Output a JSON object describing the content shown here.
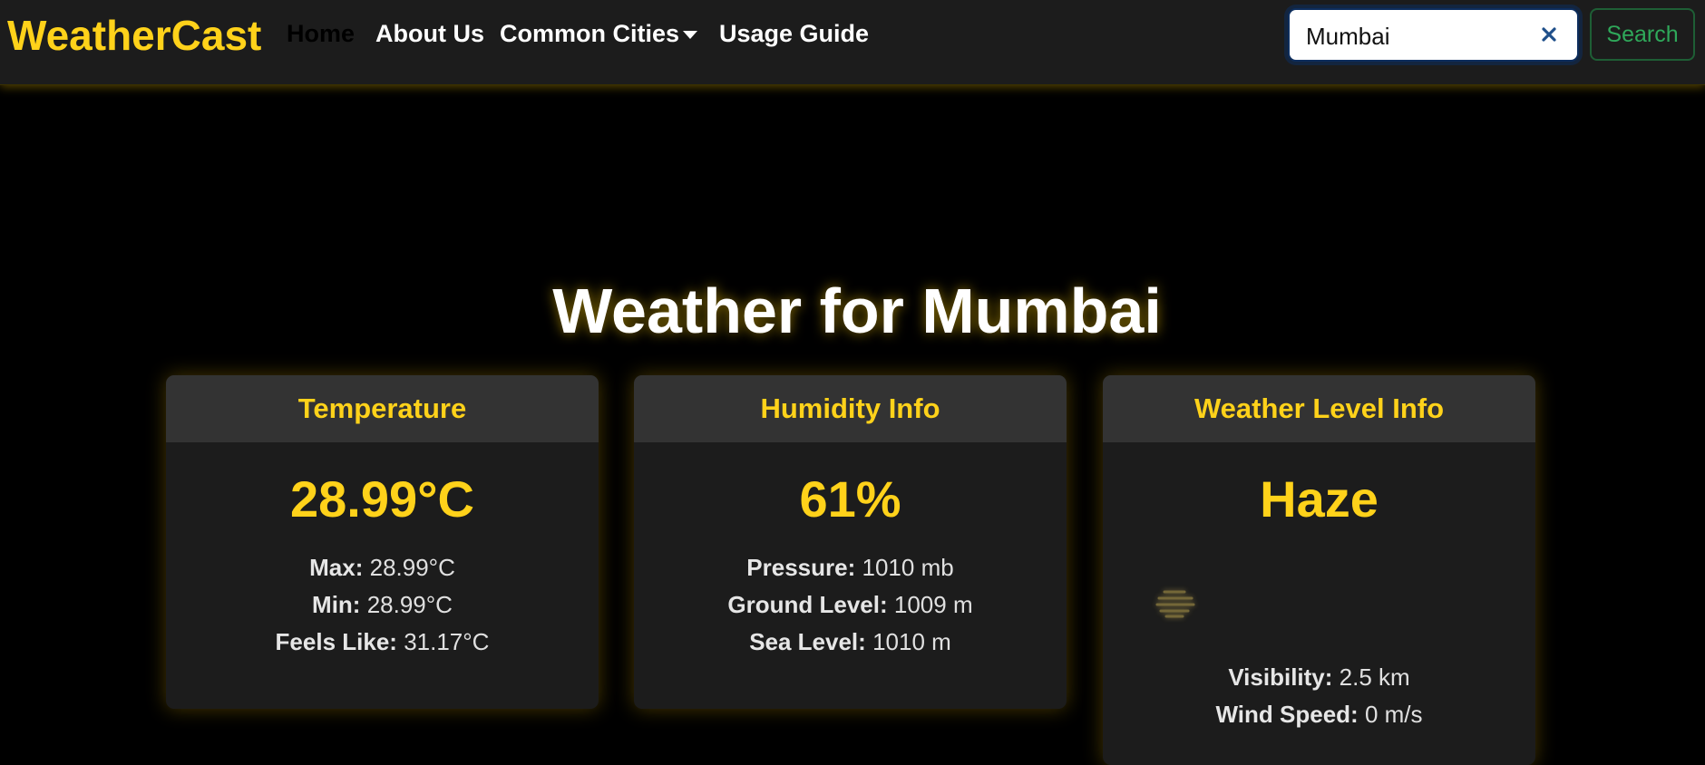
{
  "navbar": {
    "brand": "WeatherCast",
    "links": {
      "home": "Home",
      "about": "About Us",
      "cities": "Common Cities",
      "guide": "Usage Guide"
    },
    "search": {
      "value": "Mumbai",
      "button_label": "Search"
    }
  },
  "main": {
    "title": "Weather for Mumbai",
    "cards": {
      "temperature": {
        "header": "Temperature",
        "value": "28.99°C",
        "lines": [
          {
            "label": "Max:",
            "value": "28.99°C"
          },
          {
            "label": "Min:",
            "value": "28.99°C"
          },
          {
            "label": "Feels Like:",
            "value": "31.17°C"
          }
        ]
      },
      "humidity": {
        "header": "Humidity Info",
        "value": "61%",
        "lines": [
          {
            "label": "Pressure:",
            "value": "1010 mb"
          },
          {
            "label": "Ground Level:",
            "value": "1009 m"
          },
          {
            "label": "Sea Level:",
            "value": "1010 m"
          }
        ]
      },
      "weather": {
        "header": "Weather Level Info",
        "value": "Haze",
        "icon": "haze-icon",
        "lines": [
          {
            "label": "Visibility:",
            "value": "2.5 km"
          },
          {
            "label": "Wind Speed:",
            "value": "0 m/s"
          }
        ]
      }
    }
  },
  "colors": {
    "accent": "#ffd21a",
    "background": "#000000",
    "card": "#1c1c1c",
    "card_header": "#333333",
    "search_button": "#2fa85a"
  }
}
